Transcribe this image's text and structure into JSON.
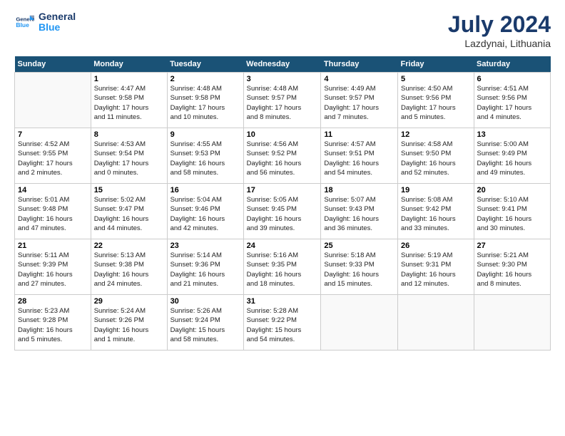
{
  "header": {
    "logo_line1": "General",
    "logo_line2": "Blue",
    "month_year": "July 2024",
    "location": "Lazdynai, Lithuania"
  },
  "weekdays": [
    "Sunday",
    "Monday",
    "Tuesday",
    "Wednesday",
    "Thursday",
    "Friday",
    "Saturday"
  ],
  "weeks": [
    [
      {
        "day": "",
        "text": ""
      },
      {
        "day": "1",
        "text": "Sunrise: 4:47 AM\nSunset: 9:58 PM\nDaylight: 17 hours\nand 11 minutes."
      },
      {
        "day": "2",
        "text": "Sunrise: 4:48 AM\nSunset: 9:58 PM\nDaylight: 17 hours\nand 10 minutes."
      },
      {
        "day": "3",
        "text": "Sunrise: 4:48 AM\nSunset: 9:57 PM\nDaylight: 17 hours\nand 8 minutes."
      },
      {
        "day": "4",
        "text": "Sunrise: 4:49 AM\nSunset: 9:57 PM\nDaylight: 17 hours\nand 7 minutes."
      },
      {
        "day": "5",
        "text": "Sunrise: 4:50 AM\nSunset: 9:56 PM\nDaylight: 17 hours\nand 5 minutes."
      },
      {
        "day": "6",
        "text": "Sunrise: 4:51 AM\nSunset: 9:56 PM\nDaylight: 17 hours\nand 4 minutes."
      }
    ],
    [
      {
        "day": "7",
        "text": "Sunrise: 4:52 AM\nSunset: 9:55 PM\nDaylight: 17 hours\nand 2 minutes."
      },
      {
        "day": "8",
        "text": "Sunrise: 4:53 AM\nSunset: 9:54 PM\nDaylight: 17 hours\nand 0 minutes."
      },
      {
        "day": "9",
        "text": "Sunrise: 4:55 AM\nSunset: 9:53 PM\nDaylight: 16 hours\nand 58 minutes."
      },
      {
        "day": "10",
        "text": "Sunrise: 4:56 AM\nSunset: 9:52 PM\nDaylight: 16 hours\nand 56 minutes."
      },
      {
        "day": "11",
        "text": "Sunrise: 4:57 AM\nSunset: 9:51 PM\nDaylight: 16 hours\nand 54 minutes."
      },
      {
        "day": "12",
        "text": "Sunrise: 4:58 AM\nSunset: 9:50 PM\nDaylight: 16 hours\nand 52 minutes."
      },
      {
        "day": "13",
        "text": "Sunrise: 5:00 AM\nSunset: 9:49 PM\nDaylight: 16 hours\nand 49 minutes."
      }
    ],
    [
      {
        "day": "14",
        "text": "Sunrise: 5:01 AM\nSunset: 9:48 PM\nDaylight: 16 hours\nand 47 minutes."
      },
      {
        "day": "15",
        "text": "Sunrise: 5:02 AM\nSunset: 9:47 PM\nDaylight: 16 hours\nand 44 minutes."
      },
      {
        "day": "16",
        "text": "Sunrise: 5:04 AM\nSunset: 9:46 PM\nDaylight: 16 hours\nand 42 minutes."
      },
      {
        "day": "17",
        "text": "Sunrise: 5:05 AM\nSunset: 9:45 PM\nDaylight: 16 hours\nand 39 minutes."
      },
      {
        "day": "18",
        "text": "Sunrise: 5:07 AM\nSunset: 9:43 PM\nDaylight: 16 hours\nand 36 minutes."
      },
      {
        "day": "19",
        "text": "Sunrise: 5:08 AM\nSunset: 9:42 PM\nDaylight: 16 hours\nand 33 minutes."
      },
      {
        "day": "20",
        "text": "Sunrise: 5:10 AM\nSunset: 9:41 PM\nDaylight: 16 hours\nand 30 minutes."
      }
    ],
    [
      {
        "day": "21",
        "text": "Sunrise: 5:11 AM\nSunset: 9:39 PM\nDaylight: 16 hours\nand 27 minutes."
      },
      {
        "day": "22",
        "text": "Sunrise: 5:13 AM\nSunset: 9:38 PM\nDaylight: 16 hours\nand 24 minutes."
      },
      {
        "day": "23",
        "text": "Sunrise: 5:14 AM\nSunset: 9:36 PM\nDaylight: 16 hours\nand 21 minutes."
      },
      {
        "day": "24",
        "text": "Sunrise: 5:16 AM\nSunset: 9:35 PM\nDaylight: 16 hours\nand 18 minutes."
      },
      {
        "day": "25",
        "text": "Sunrise: 5:18 AM\nSunset: 9:33 PM\nDaylight: 16 hours\nand 15 minutes."
      },
      {
        "day": "26",
        "text": "Sunrise: 5:19 AM\nSunset: 9:31 PM\nDaylight: 16 hours\nand 12 minutes."
      },
      {
        "day": "27",
        "text": "Sunrise: 5:21 AM\nSunset: 9:30 PM\nDaylight: 16 hours\nand 8 minutes."
      }
    ],
    [
      {
        "day": "28",
        "text": "Sunrise: 5:23 AM\nSunset: 9:28 PM\nDaylight: 16 hours\nand 5 minutes."
      },
      {
        "day": "29",
        "text": "Sunrise: 5:24 AM\nSunset: 9:26 PM\nDaylight: 16 hours\nand 1 minute."
      },
      {
        "day": "30",
        "text": "Sunrise: 5:26 AM\nSunset: 9:24 PM\nDaylight: 15 hours\nand 58 minutes."
      },
      {
        "day": "31",
        "text": "Sunrise: 5:28 AM\nSunset: 9:22 PM\nDaylight: 15 hours\nand 54 minutes."
      },
      {
        "day": "",
        "text": ""
      },
      {
        "day": "",
        "text": ""
      },
      {
        "day": "",
        "text": ""
      }
    ]
  ]
}
